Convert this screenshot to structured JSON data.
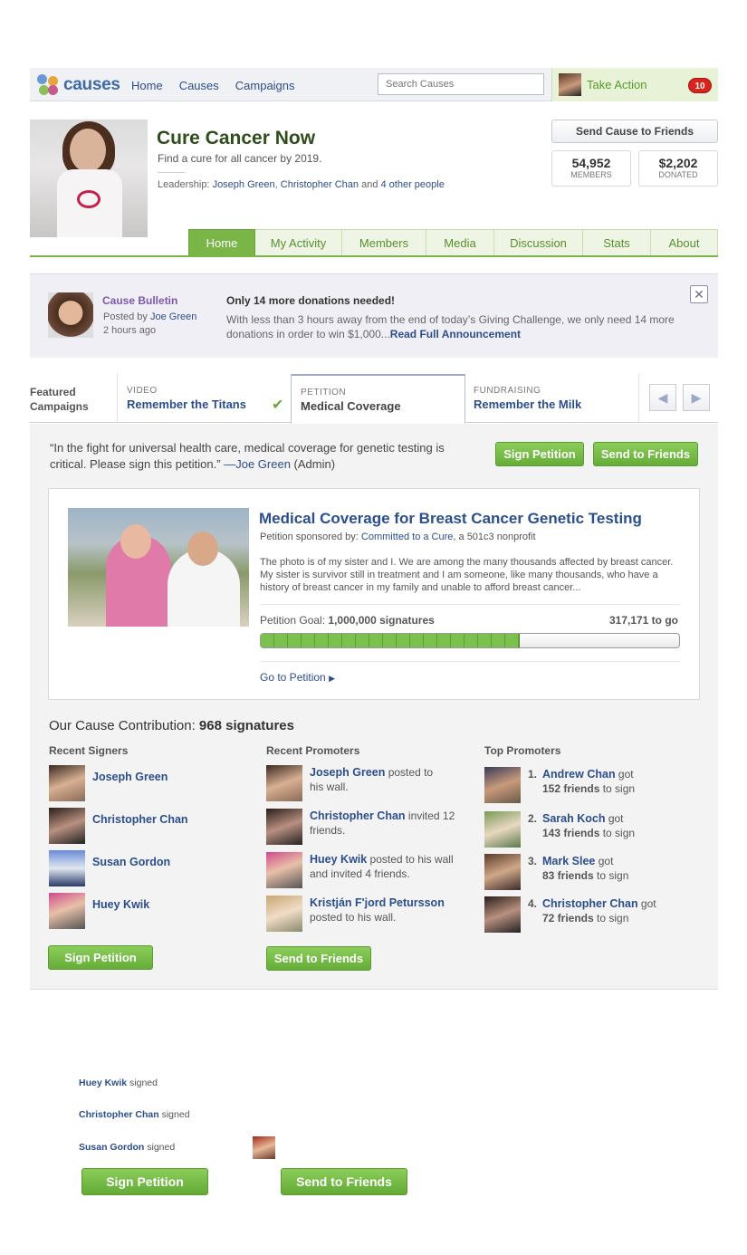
{
  "topbar": {
    "logo_text": "causes",
    "nav": [
      "Home",
      "Causes",
      "Campaigns"
    ],
    "search_placeholder": "Search Causes",
    "take_action_label": "Take Action",
    "take_action_count": "10"
  },
  "cause": {
    "title": "Cure Cancer Now",
    "subtitle": "Find a cure for all cancer by 2019.",
    "leadership_label": "Leadership:",
    "leader1": "Joseph Green",
    "leader2": "Christopher Chan",
    "leader_and": "and",
    "leader_others": "4 other people",
    "send_cause_label": "Send Cause to Friends",
    "members_count": "54,952",
    "members_label": "MEMBERS",
    "donated_amount": "$2,202",
    "donated_label": "DONATED"
  },
  "tabs": [
    "Home",
    "My Activity",
    "Members",
    "Media",
    "Discussion",
    "Stats",
    "About"
  ],
  "bulletin": {
    "title": "Cause Bulletin",
    "posted_by_label": "Posted by",
    "author": "Joe Green",
    "time": "2 hours ago",
    "headline": "Only 14 more donations needed!",
    "body": "With less than 3 hours away from the end of today’s Giving Challenge, we only need 14 more donations in order to win $1,000...",
    "read_more": "Read Full Announcement",
    "close_icon": "close-icon"
  },
  "campaigns": {
    "featured_label_line1": "Featured",
    "featured_label_line2": "Campaigns",
    "items": [
      {
        "kind": "VIDEO",
        "name": "Remember the Titans"
      },
      {
        "kind": "PETITION",
        "name": "Medical Coverage"
      },
      {
        "kind": "FUNDRAISING",
        "name": "Remember the Milk"
      }
    ],
    "prev_icon": "triangle-left-icon",
    "next_icon": "triangle-right-icon"
  },
  "petition": {
    "quote": "“In the fight for universal health care, medical coverage for genetic testing is critical. Please sign this petition.”",
    "quote_author": "—Joe Green",
    "quote_role": "(Admin)",
    "sign_label": "Sign Petition",
    "send_label": "Send to Friends",
    "card_title": "Medical Coverage for Breast Cancer Genetic Testing",
    "sponsor_prefix": "Petition sponsored by:",
    "sponsor_name": "Committed to a Cure",
    "sponsor_suffix": ", a 501c3 nonprofit",
    "description": "The photo is of my sister and I. We are among the many thousands affected by breast cancer. My sister is survivor still in treatment and I am someone, like many thousands, who have a history of breast cancer in my family and unable to afford breast cancer...",
    "goal_label": "Petition Goal:",
    "goal_value": "1,000,000 signatures",
    "remaining": "317,171 to go",
    "progress_fraction": 0.62,
    "goto_label": "Go to Petition"
  },
  "contribution": {
    "label": "Our Cause Contribution:",
    "value": "968 signatures",
    "recent_signers_title": "Recent Signers",
    "recent_signers": [
      "Joseph Green",
      "Christopher Chan",
      "Susan Gordon",
      "Huey Kwik"
    ],
    "recent_promoters_title": "Recent Promoters",
    "recent_promoters": [
      {
        "name": "Joseph Green",
        "action": " posted to his wall."
      },
      {
        "name": "Christopher Chan",
        "action": " invited 12 friends."
      },
      {
        "name": "Huey Kwik",
        "action": " posted to his wall and invited 4 friends."
      },
      {
        "name": "Kristján F'jord Petursson",
        "action": " posted to his wall."
      }
    ],
    "top_promoters_title": "Top Promoters",
    "top_promoters": [
      {
        "rank": "1.",
        "name": "Andrew Chan",
        "got": " got",
        "count": "152 friends",
        "tail": " to sign"
      },
      {
        "rank": "2.",
        "name": "Sarah Koch",
        "got": " got",
        "count": "143 friends",
        "tail": " to sign"
      },
      {
        "rank": "3.",
        "name": "Mark Slee",
        "got": " got",
        "count": "83 friends",
        "tail": " to sign"
      },
      {
        "rank": "4.",
        "name": "Christopher Chan",
        "got": " got",
        "count": "72 friends",
        "tail": " to sign"
      }
    ],
    "sign_label": "Sign Petition",
    "send_label": "Send to Friends"
  },
  "footer": {
    "feed": [
      {
        "name": "Huey Kwik",
        "action": " signed"
      },
      {
        "name": "Christopher Chan",
        "action": " signed"
      },
      {
        "name": "Susan Gordon",
        "action": " signed"
      }
    ],
    "sign_label": "Sign Petition",
    "send_label": "Send to Friends"
  }
}
